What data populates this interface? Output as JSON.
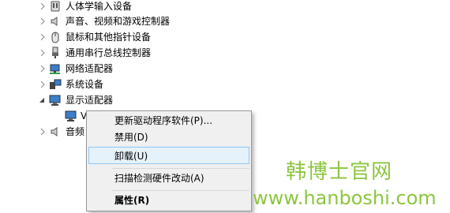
{
  "tree": {
    "items": [
      {
        "label": "人体学输入设备",
        "icon": "hid-icon",
        "expanded": false
      },
      {
        "label": "声音、视频和游戏控制器",
        "icon": "speaker-icon",
        "expanded": false
      },
      {
        "label": "鼠标和其他指针设备",
        "icon": "mouse-icon",
        "expanded": false
      },
      {
        "label": "通用串行总线控制器",
        "icon": "usb-icon",
        "expanded": false
      },
      {
        "label": "网络适配器",
        "icon": "network-adapter-icon",
        "expanded": false
      },
      {
        "label": "系统设备",
        "icon": "system-device-icon",
        "expanded": false
      },
      {
        "label": "显示适配器",
        "icon": "display-adapter-icon",
        "expanded": true
      },
      {
        "label": "V",
        "icon": "monitor-icon",
        "child": true
      },
      {
        "label": "音频",
        "icon": "speaker-icon",
        "expanded": false
      }
    ]
  },
  "context_menu": {
    "items": [
      {
        "label": "更新驱动程序软件(P)...",
        "state": "normal"
      },
      {
        "label": "禁用(D)",
        "state": "normal"
      },
      {
        "label": "卸载(U)",
        "state": "hover"
      },
      {
        "label": "扫描检测硬件改动(A)",
        "state": "normal"
      },
      {
        "label": "属性(R)",
        "state": "bold"
      }
    ]
  },
  "watermark": {
    "line1": "韩博士官网",
    "line2": "www.hanboshi.com",
    "color": "#8cc63f"
  }
}
